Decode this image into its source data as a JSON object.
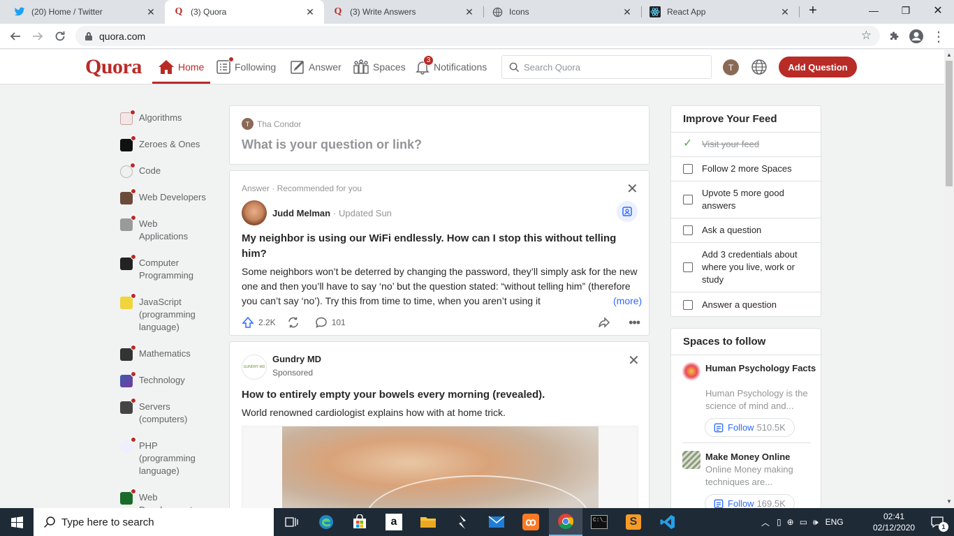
{
  "browser": {
    "tabs": [
      {
        "title": "(20) Home / Twitter",
        "icon": "twitter-icon",
        "active": false
      },
      {
        "title": "(3) Quora",
        "icon": "quora-icon",
        "active": true
      },
      {
        "title": "(3) Write Answers",
        "icon": "quora-icon",
        "active": false
      },
      {
        "title": "Icons",
        "icon": "globe-icon",
        "active": false
      },
      {
        "title": "React App",
        "icon": "react-icon",
        "active": false
      }
    ],
    "url": "quora.com"
  },
  "header": {
    "logo": "Quora",
    "nav": [
      {
        "label": "Home",
        "active": true
      },
      {
        "label": "Following"
      },
      {
        "label": "Answer"
      },
      {
        "label": "Spaces"
      },
      {
        "label": "Notifications",
        "badge": "3"
      }
    ],
    "search_placeholder": "Search Quora",
    "avatar_initial": "T",
    "add_question": "Add Question"
  },
  "sidebar": {
    "items": [
      {
        "label": "Algorithms",
        "color": "#c9c9c9"
      },
      {
        "label": "Zeroes & Ones",
        "color": "#111111"
      },
      {
        "label": "Code",
        "color": "#e0e0e0"
      },
      {
        "label": "Web Developers",
        "color": "#6b4a3a"
      },
      {
        "label": "Web Applications",
        "color": "#9a9a9a"
      },
      {
        "label": "Computer Programming",
        "color": "#222222"
      },
      {
        "label": "JavaScript (programming language)",
        "color": "#f0d53c"
      },
      {
        "label": "Mathematics",
        "color": "#333333"
      },
      {
        "label": "Technology",
        "color": "#3a5ab0"
      },
      {
        "label": "Servers (computers)",
        "color": "#444444"
      },
      {
        "label": "PHP (programming language)",
        "color": "#6a70a8"
      },
      {
        "label": "Web Development",
        "color": "#1a6b2a"
      }
    ]
  },
  "ask_box": {
    "user": "Tha Condor",
    "avatar_initial": "T",
    "prompt": "What is your question or link?"
  },
  "answer_card": {
    "meta": "Answer · Recommended for you",
    "author": "Judd Melman",
    "date": "· Updated Sun",
    "title": "My neighbor is using our WiFi endlessly. How can I stop this without telling him?",
    "body": "Some neighbors won’t be deterred by changing the password, they’ll simply ask for the new one and then you’ll have to say ‘no’ but the question stated: “without telling him” (therefore you can’t say ‘no’). Try this from time to time, when you aren’t using it",
    "more": "(more)",
    "upvotes": "2.2K",
    "comments": "101"
  },
  "ad_card": {
    "advertiser": "Gundry MD",
    "sponsored": "Sponsored",
    "logo_text": "GUNDRY MD",
    "title": "How to entirely empty your bowels every morning (revealed).",
    "body": "World renowned cardiologist explains how with at home trick."
  },
  "improve_feed": {
    "title": "Improve Your Feed",
    "items": [
      {
        "label": "Visit your feed",
        "done": true
      },
      {
        "label": "Follow 2 more Spaces",
        "done": false
      },
      {
        "label": "Upvote 5 more good answers",
        "done": false
      },
      {
        "label": "Ask a question",
        "done": false
      },
      {
        "label": "Add 3 credentials about where you live, work or study",
        "done": false
      },
      {
        "label": "Answer a question",
        "done": false
      }
    ]
  },
  "spaces": {
    "title": "Spaces to follow",
    "items": [
      {
        "name": "Human Psychology Facts",
        "desc": "Human Psychology is the science of mind and...",
        "follow": "Follow",
        "count": "510.5K"
      },
      {
        "name": "Make Money Online",
        "desc": "Online Money making techniques are...",
        "follow": "Follow",
        "count": "169.5K"
      }
    ]
  },
  "taskbar": {
    "search_placeholder": "Type here to search",
    "lang": "ENG",
    "time": "02:41",
    "date": "02/12/2020",
    "notif_count": "1"
  }
}
